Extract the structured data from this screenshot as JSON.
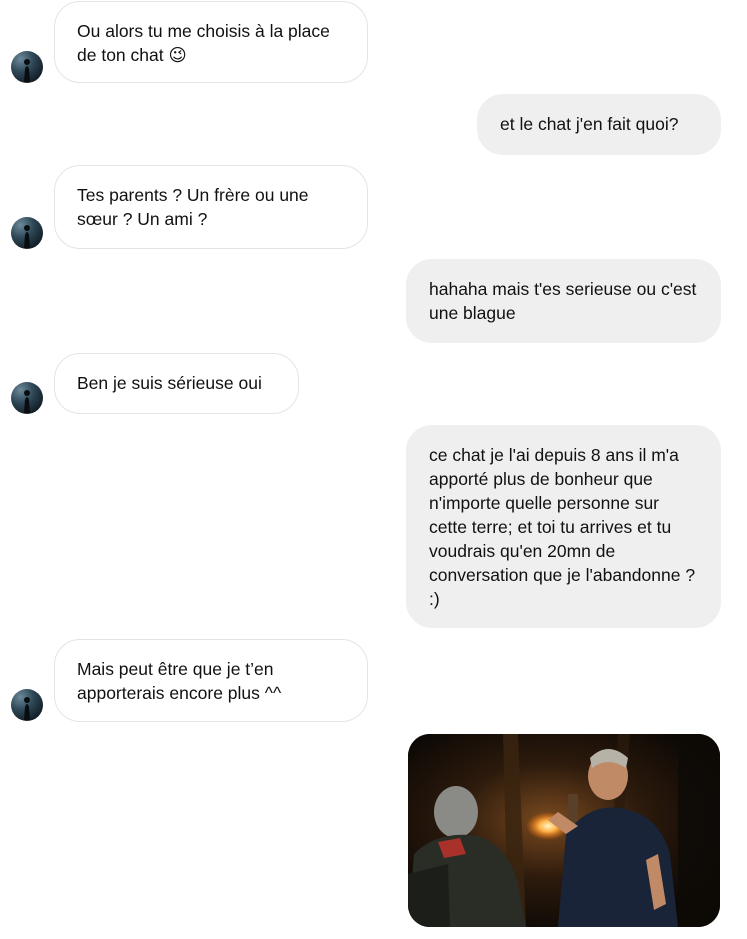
{
  "messages": [
    {
      "sender": "other",
      "text": "Ou alors tu me choisis à la place de ton chat 😉"
    },
    {
      "sender": "me",
      "text": "et le chat j'en fait quoi?"
    },
    {
      "sender": "other",
      "text": "Tes parents ? Un frère ou une sœur ? Un ami ?"
    },
    {
      "sender": "me",
      "text": "hahaha mais t'es serieuse ou c'est une blague"
    },
    {
      "sender": "other",
      "text": "Ben je suis sérieuse oui"
    },
    {
      "sender": "me",
      "text": "ce chat je l'ai depuis 8 ans il m'a apporté plus de bonheur que n'importe quelle personne sur cette terre; et toi tu arrives et tu voudrais qu'en 20mn de conversation que je l'abandonne ? :)"
    },
    {
      "sender": "other",
      "text": "Mais peut être que je t’en apporterais encore plus ^^"
    },
    {
      "sender": "me",
      "type": "image",
      "image": "photo-two-men-torch-night"
    }
  ],
  "colors": {
    "incoming_bubble_bg": "#ffffff",
    "incoming_bubble_border": "#e4e4e4",
    "outgoing_bubble_bg": "#efefef",
    "text": "#111111"
  }
}
